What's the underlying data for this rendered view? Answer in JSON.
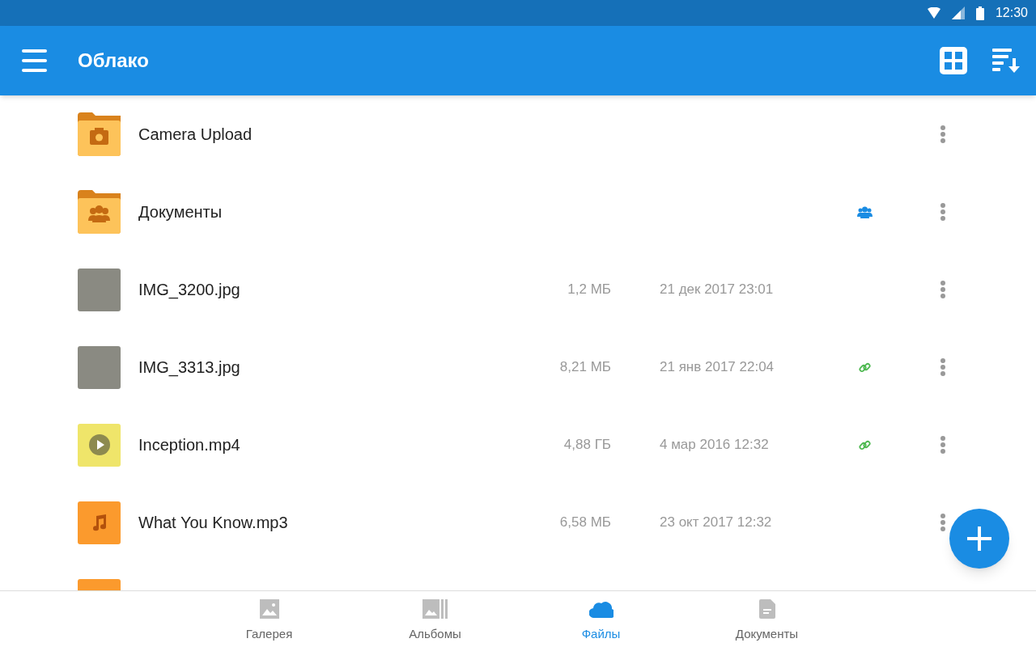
{
  "status_bar": {
    "time": "12:30"
  },
  "app_bar": {
    "title": "Облако"
  },
  "files": [
    {
      "kind": "folder-camera",
      "name": "Camera Upload",
      "shared": false,
      "link": false
    },
    {
      "kind": "folder-shared",
      "name": "Документы",
      "shared": true,
      "link": false
    },
    {
      "kind": "image",
      "name": "IMG_3200.jpg",
      "size": "1,2 МБ",
      "date": "21 дек 2017 23:01",
      "shared": false,
      "link": false
    },
    {
      "kind": "image",
      "name": "IMG_3313.jpg",
      "size": "8,21 МБ",
      "date": "21 янв 2017 22:04",
      "shared": false,
      "link": true
    },
    {
      "kind": "video",
      "name": "Inception.mp4",
      "size": "4,88 ГБ",
      "date": "4 мар 2016 12:32",
      "shared": false,
      "link": true
    },
    {
      "kind": "audio",
      "name": "What You Know.mp3",
      "size": "6,58 МБ",
      "date": "23 окт 2017 12:32",
      "shared": false,
      "link": false
    },
    {
      "kind": "audio",
      "shared": false,
      "link": false
    }
  ],
  "bottom_nav": [
    {
      "kind": "gallery",
      "label": "Галерея",
      "selected": false
    },
    {
      "kind": "albums",
      "label": "Альбомы",
      "selected": false
    },
    {
      "kind": "files",
      "label": "Файлы",
      "selected": true
    },
    {
      "kind": "documents",
      "label": "Документы",
      "selected": false
    }
  ]
}
